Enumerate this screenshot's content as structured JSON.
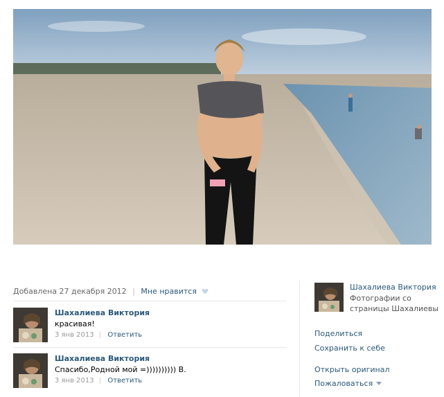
{
  "photo": {
    "meta": {
      "added": "Добавлена 27 декабря 2012",
      "separator": "|",
      "like": "Мне нравится"
    }
  },
  "comments": [
    {
      "author": "Шахалиева Виктория",
      "text": "красивая!",
      "date": "3 янв 2013",
      "reply": "Ответить"
    },
    {
      "author": "Шахалиева Виктория",
      "text": "Спасибо,Родной мой =)))))))))) В.",
      "date": "3 янв 2013",
      "reply": "Ответить"
    }
  ],
  "sidebar": {
    "album_title": "Шахалиева Виктория",
    "album_subtitle": "Фотографии со страницы Шахалиевы",
    "actions": {
      "share": "Поделиться",
      "save": "Сохранить к себе",
      "open_original": "Открыть оригинал",
      "report": "Пожаловаться"
    }
  },
  "colors": {
    "link": "#2b587a",
    "meta": "#666666",
    "divider": "#e7e8ec"
  }
}
